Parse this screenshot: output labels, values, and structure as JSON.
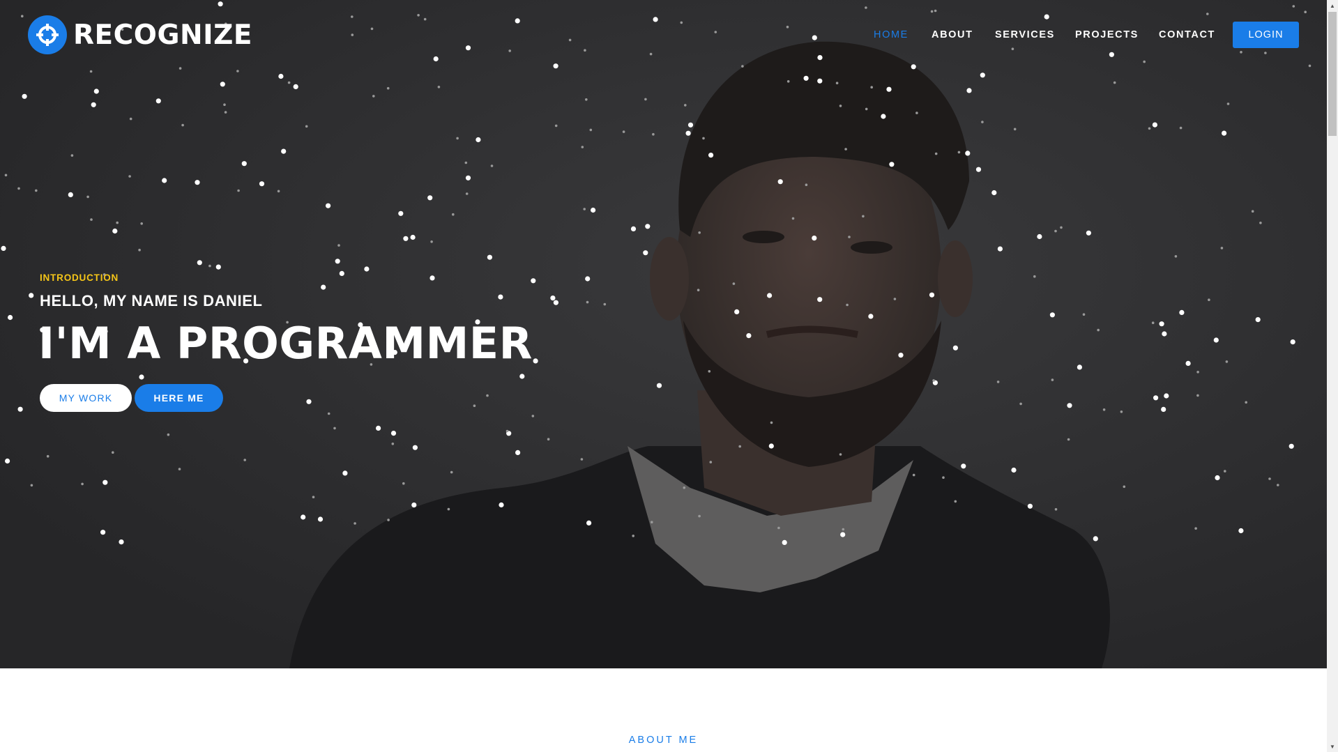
{
  "brand": {
    "name": "RECOGNIZE",
    "logo_icon": "crosshair-icon",
    "accent_color": "#1a7de8"
  },
  "nav": {
    "items": [
      {
        "label": "HOME",
        "active": true
      },
      {
        "label": "ABOUT",
        "active": false
      },
      {
        "label": "SERVICES",
        "active": false
      },
      {
        "label": "PROJECTS",
        "active": false
      },
      {
        "label": "CONTACT",
        "active": false
      }
    ],
    "login_label": "LOGIN"
  },
  "hero": {
    "eyebrow": "INTRODUCTION",
    "eyebrow_color": "#f5c518",
    "greeting": "HELLO, MY NAME IS DANIEL",
    "headline": "I'M A PROGRAMMER",
    "buttons": {
      "primary_label": "MY WORK",
      "secondary_label": "HERE ME"
    }
  },
  "about": {
    "section_label": "ABOUT ME"
  }
}
